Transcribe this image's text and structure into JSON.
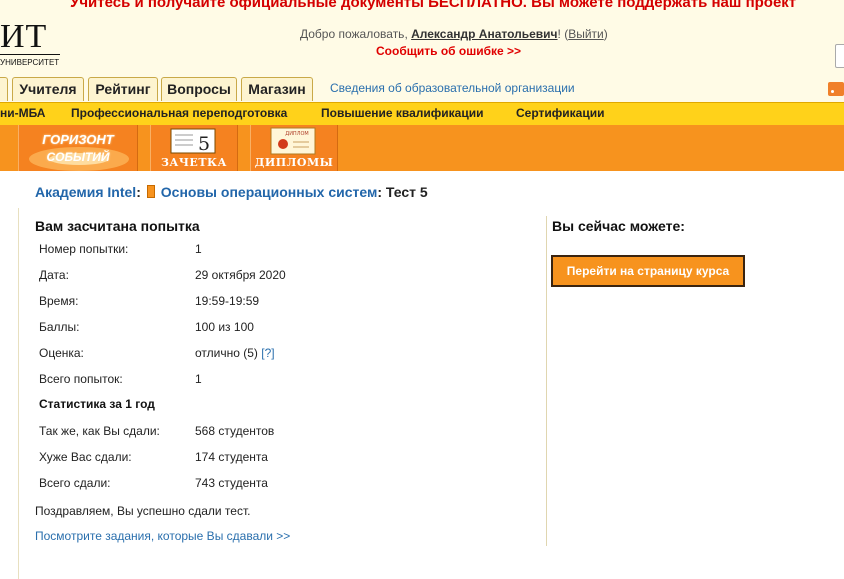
{
  "banner": {
    "text": "Учитесь и получайте официальные документы БЕСПЛАТНО. Вы можете поддержать наш проект"
  },
  "header": {
    "logo_text": "ИТ",
    "logo_subtext": "УНИВЕРСИТЕТ",
    "welcome_prefix": "Добро пожаловать, ",
    "user_name": "Александр Анатольевич",
    "welcome_exclaim": "! (",
    "logout_label": "Выйти",
    "welcome_close": ")",
    "report_error": "Сообщить об ошибке >>"
  },
  "tabs": [
    {
      "label": ""
    },
    {
      "label": "Учителя"
    },
    {
      "label": "Рейтинг"
    },
    {
      "label": "Вопросы"
    },
    {
      "label": "Магазин"
    }
  ],
  "info_link": "Сведения об образовательной организации",
  "menu": [
    {
      "label": "ни-МБА"
    },
    {
      "label": "Профессиональная переподготовка"
    },
    {
      "label": "Повышение квалификации"
    },
    {
      "label": "Сертификации"
    }
  ],
  "strip": {
    "horizon_line1": "ГОРИЗОНТ",
    "horizon_line2": "СОБЫТИЙ",
    "gradebook_mark": "5",
    "gradebook_label": "ЗАЧЕТКА",
    "diplomas_badge": "ДИПЛОМ",
    "diplomas_label": "ДИПЛОМЫ"
  },
  "breadcrumb": {
    "academy": "Академия Intel",
    "sep1": ": ",
    "course": "Основы операционных систем",
    "sep2": ": ",
    "test": "Тест 5"
  },
  "result": {
    "title": "Вам засчитана попытка",
    "rows": [
      {
        "label": "Номер попытки:",
        "value": "1"
      },
      {
        "label": "Дата:",
        "value": "29 октября 2020"
      },
      {
        "label": "Время:",
        "value": "19:59-19:59"
      },
      {
        "label": "Баллы:",
        "value": "100 из 100"
      },
      {
        "label": "Оценка:",
        "value": "отлично (5) ",
        "help": "[?]"
      },
      {
        "label": "Всего попыток:",
        "value": "1"
      }
    ],
    "stats_title": "Статистика за 1 год",
    "stats": [
      {
        "label": "Так же, как Вы сдали:",
        "value": "568 студентов"
      },
      {
        "label": "Хуже Вас сдали:",
        "value": "174 студента"
      },
      {
        "label": "Всего сдали:",
        "value": "743 студента"
      }
    ],
    "congrats": "Поздравляем, Вы успешно сдали тест.",
    "tasks_link": "Посмотрите задания, которые Вы сдавали >>"
  },
  "actions": {
    "title": "Вы сейчас можете:",
    "course_button": "Перейти на страницу курса"
  }
}
